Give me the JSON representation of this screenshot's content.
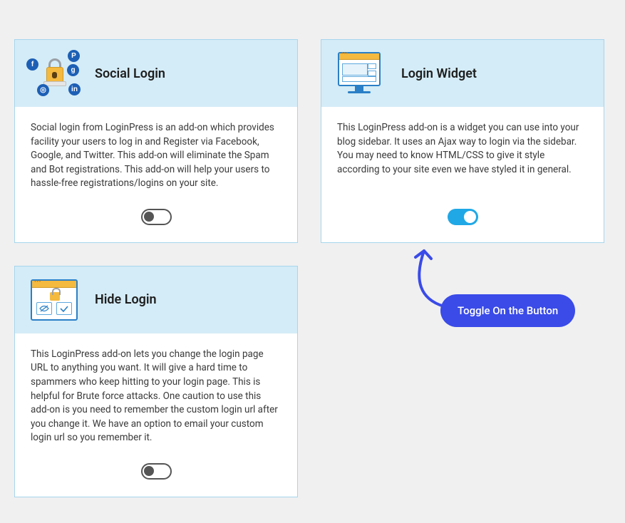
{
  "cards": {
    "social_login": {
      "title": "Social Login",
      "description": "Social login from LoginPress is an add-on which provides facility your users to log in and Register via Facebook, Google, and Twitter. This add-on will eliminate the Spam and Bot registrations. This add-on will help your users to hassle-free registrations/logins on your site."
    },
    "login_widget": {
      "title": "Login Widget",
      "description": "This LoginPress add-on is a widget you can use into your blog sidebar. It uses an Ajax way to login via the sidebar. You may need to know HTML/CSS to give it style according to your site even we have styled it in general."
    },
    "hide_login": {
      "title": "Hide Login",
      "description": "This LoginPress add-on lets you change the login page URL to anything you want. It will give a hard time to spammers who keep hitting to your login page. This is helpful for Brute force attacks. One caution to use this add-on is you need to remember the custom login url after you change it. We have an option to email your custom login url so you remember it."
    }
  },
  "callout": {
    "label": "Toggle On the Button"
  },
  "social_icons": {
    "p": "P",
    "f": "f",
    "g": "g",
    "ig": "◎",
    "in": "in"
  },
  "hide_icons": {
    "eye": "👁",
    "check": "✓"
  }
}
